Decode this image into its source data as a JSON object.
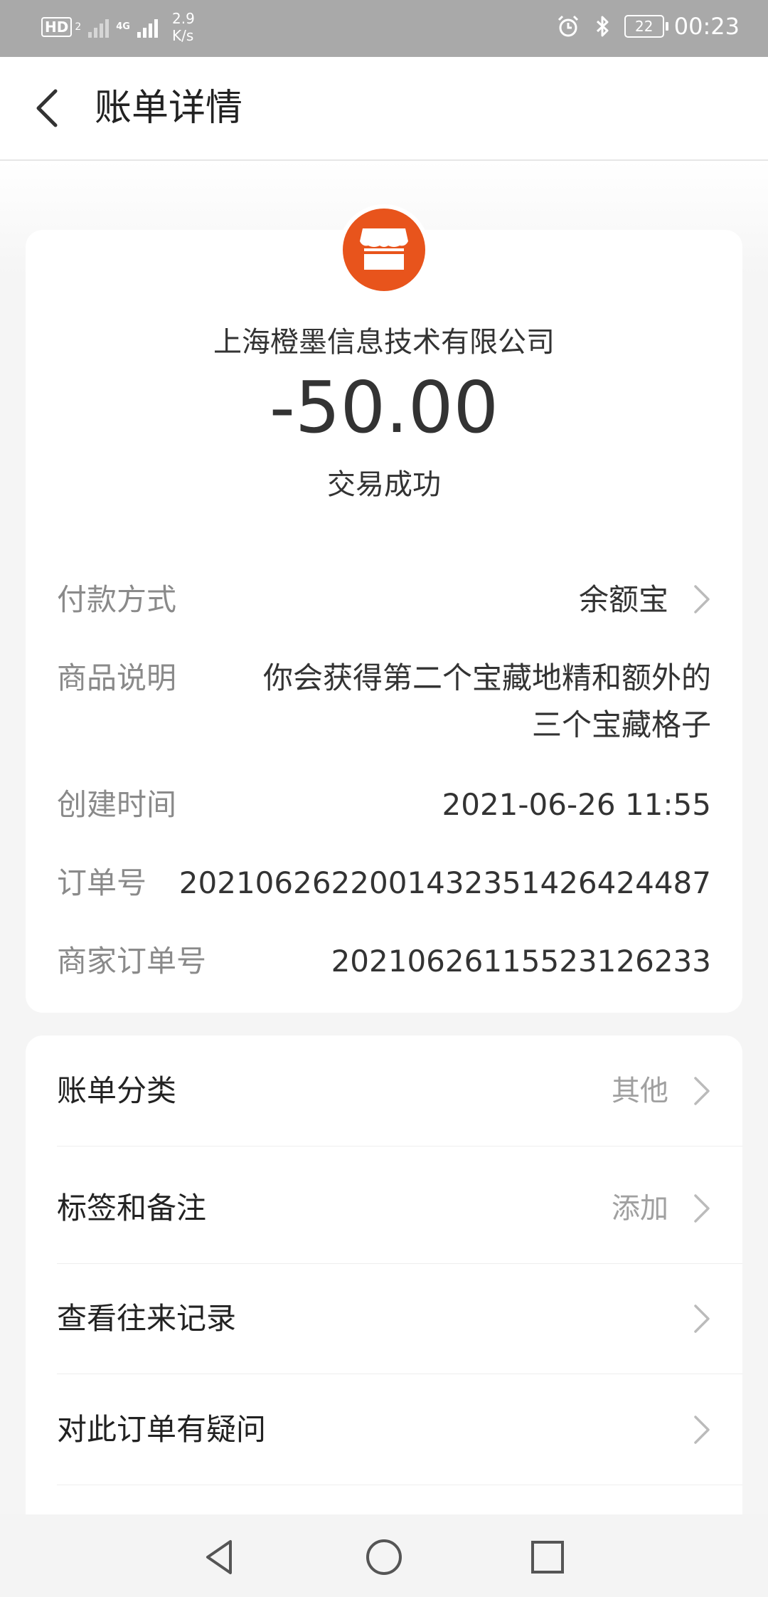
{
  "status_bar": {
    "network_badge": "HD",
    "sim_index": "2",
    "net_type": "4G",
    "net_speed_value": "2.9",
    "net_speed_unit": "K/s",
    "battery": "22",
    "time": "00:23",
    "icons": [
      "alarm-icon",
      "bluetooth-icon",
      "battery-icon"
    ]
  },
  "header": {
    "title": "账单详情",
    "back_icon": "chevron-left-icon"
  },
  "transaction": {
    "merchant_icon": "store-icon",
    "merchant_icon_color": "#e8541c",
    "merchant_name": "上海橙墨信息技术有限公司",
    "amount": "-50.00",
    "status": "交易成功"
  },
  "details": [
    {
      "label": "付款方式",
      "value": "余额宝",
      "has_chevron": true
    },
    {
      "label": "商品说明",
      "value_line1": "你会获得第二个宝藏地精和额外的",
      "value_line2": "三个宝藏格子"
    },
    {
      "label": "创建时间",
      "value": "2021-06-26 11:55"
    },
    {
      "label": "订单号",
      "value": "2021062622001432351426424487"
    },
    {
      "label": "商家订单号",
      "value": "20210626115523126233"
    }
  ],
  "menu": [
    {
      "label": "账单分类",
      "value": "其他"
    },
    {
      "label": "标签和备注",
      "value": "添加"
    },
    {
      "label": "查看往来记录",
      "value": ""
    },
    {
      "label": "对此订单有疑问",
      "value": ""
    }
  ],
  "nav_bar": {
    "icons": [
      "back-triangle-icon",
      "home-circle-icon",
      "recents-square-icon"
    ]
  }
}
